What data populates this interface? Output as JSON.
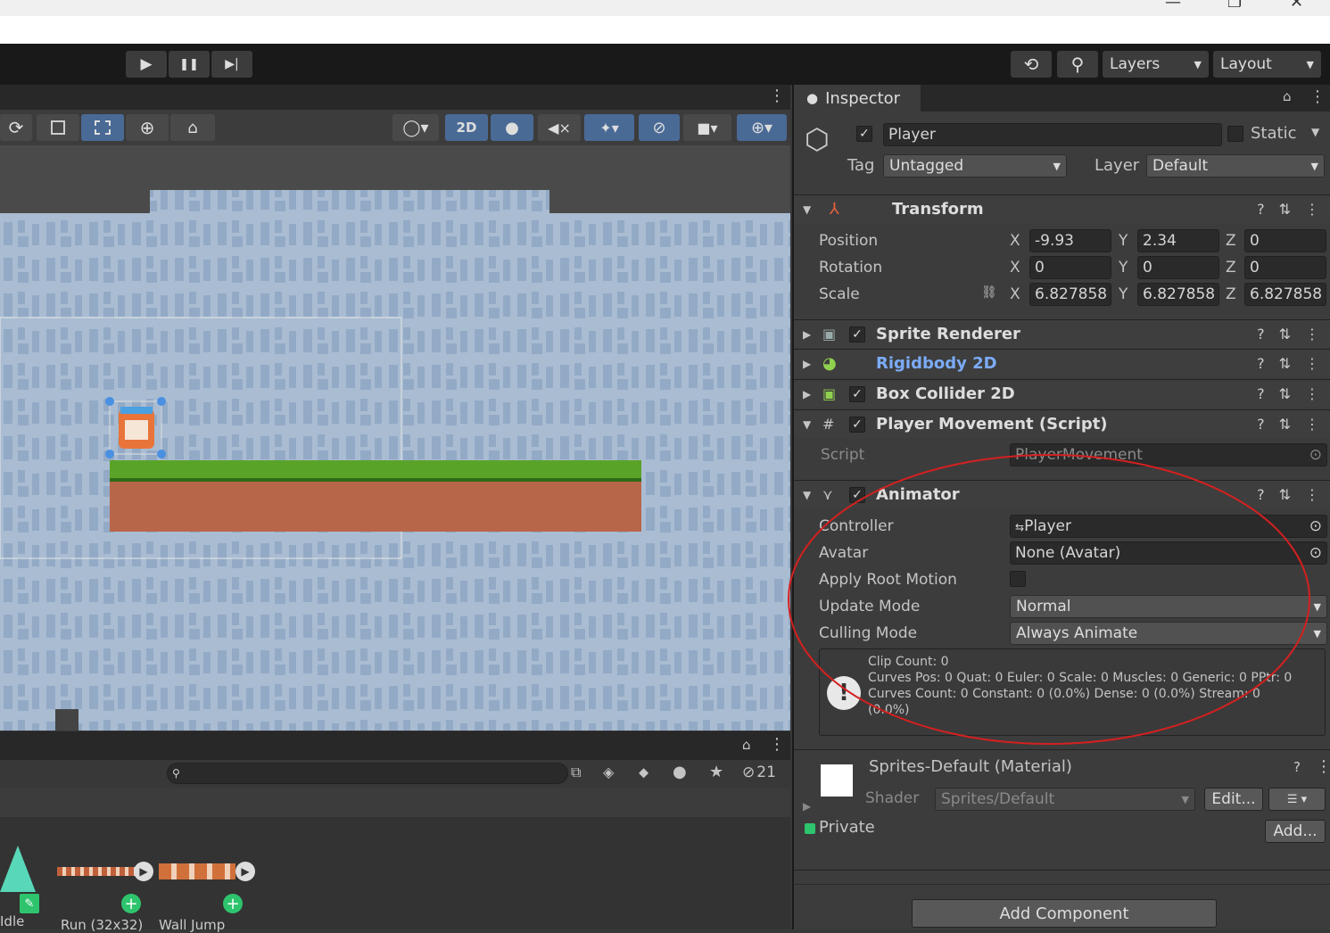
{
  "window": {
    "minimize": "—",
    "maximize": "❐",
    "close": "✕"
  },
  "toolbar": {
    "play": "▶",
    "pause": "❚❚",
    "step": "▶|",
    "history": "⟲",
    "search": "⚲",
    "layers_label": "Layers",
    "layout_label": "Layout",
    "caret": "▼"
  },
  "scene_tools": {
    "mode_2d": "2D"
  },
  "project": {
    "hidden_count": "21"
  },
  "animator_states": [
    {
      "label": "Idle"
    },
    {
      "label": "Run (32x32)"
    },
    {
      "label": "Wall Jump"
    }
  ],
  "inspector": {
    "tab_label": "Inspector",
    "object": {
      "name": "Player",
      "static_label": "Static",
      "tag_label": "Tag",
      "tag_value": "Untagged",
      "layer_label": "Layer",
      "layer_value": "Default"
    },
    "transform": {
      "title": "Transform",
      "position_label": "Position",
      "rotation_label": "Rotation",
      "scale_label": "Scale",
      "axis_x": "X",
      "axis_y": "Y",
      "axis_z": "Z",
      "position": {
        "x": "-9.93",
        "y": "2.34",
        "z": "0"
      },
      "rotation": {
        "x": "0",
        "y": "0",
        "z": "0"
      },
      "scale": {
        "x": "6.827858",
        "y": "6.827858",
        "z": "6.827858"
      }
    },
    "components": {
      "sprite_renderer": "Sprite Renderer",
      "rigidbody": "Rigidbody 2D",
      "box_collider": "Box Collider 2D",
      "player_movement": "Player Movement (Script)"
    },
    "script": {
      "label": "Script",
      "value": "PlayerMovement"
    },
    "animator": {
      "title": "Animator",
      "controller_label": "Controller",
      "controller_value": "Player",
      "avatar_label": "Avatar",
      "avatar_value": "None (Avatar)",
      "apply_root_motion_label": "Apply Root Motion",
      "update_mode_label": "Update Mode",
      "update_mode_value": "Normal",
      "culling_mode_label": "Culling Mode",
      "culling_mode_value": "Always Animate",
      "info_line1": "Clip Count: 0",
      "info_line2": "Curves Pos: 0 Quat: 0 Euler: 0 Scale: 0 Muscles: 0 Generic: 0 PPtr: 0",
      "info_line3": "Curves Count: 0 Constant: 0 (0.0%) Dense: 0 (0.0%) Stream: 0",
      "info_line4": "(0.0%)"
    },
    "material": {
      "name": "Sprites-Default (Material)",
      "shader_label": "Shader",
      "shader_value": "Sprites/Default",
      "edit_button": "Edit...",
      "private_label": "Private",
      "add_button": "Add..."
    },
    "add_component": "Add Component"
  },
  "colors": {
    "accent_blue": "#7cacf8",
    "annotation_red": "#d42020",
    "grass": "#5aa329",
    "dirt": "#b8664a",
    "scene_bg": "#a9bcd2"
  }
}
